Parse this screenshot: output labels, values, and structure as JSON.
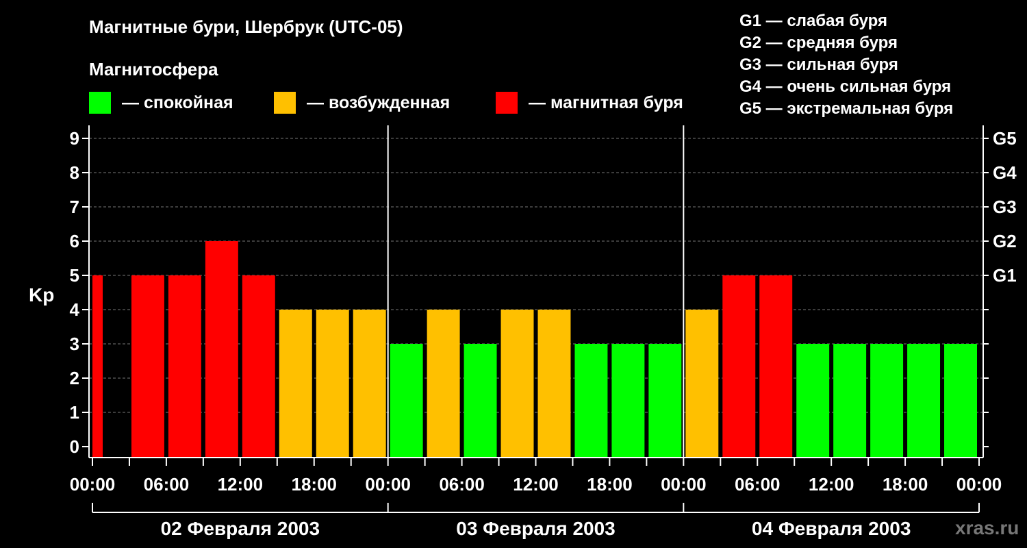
{
  "chart_data": {
    "type": "bar",
    "title": "Магнитные бури, Шербрук (UTC-05)",
    "ylabel": "Kp",
    "ylim": [
      0,
      9
    ],
    "yticks": [
      "0",
      "1",
      "2",
      "3",
      "4",
      "5",
      "6",
      "7",
      "8",
      "9"
    ],
    "g_levels": [
      {
        "label": "G1",
        "kp": 5
      },
      {
        "label": "G2",
        "kp": 6
      },
      {
        "label": "G3",
        "kp": 7
      },
      {
        "label": "G4",
        "kp": 8
      },
      {
        "label": "G5",
        "kp": 9
      }
    ],
    "legend": {
      "title": "Магнитосфера",
      "items": [
        {
          "color": "#00ff00",
          "label": "— спокойная"
        },
        {
          "color": "#ffc000",
          "label": "— возбужденная"
        },
        {
          "color": "#ff0000",
          "label": "— магнитная буря"
        }
      ]
    },
    "g_legend": [
      "G1 — слабая буря",
      "G2 — средняя буря",
      "G3 — сильная буря",
      "G4 — очень сильная буря",
      "G5 — экстремальная буря"
    ],
    "x_ticks": [
      "00:00",
      "06:00",
      "12:00",
      "18:00",
      "00:00",
      "06:00",
      "12:00",
      "18:00",
      "00:00",
      "06:00",
      "12:00",
      "18:00",
      "00:00"
    ],
    "days": [
      "02 Февраля 2003",
      "03 Февраля 2003",
      "04 Февраля 2003"
    ],
    "colors": {
      "quiet": "#00ff00",
      "active": "#ffc000",
      "storm": "#ff0000"
    },
    "bar_hours": [
      0,
      3,
      6,
      9,
      12,
      15,
      18,
      21,
      24,
      27,
      30,
      33,
      36,
      39,
      42,
      45,
      48,
      51,
      54,
      57,
      60,
      63,
      66,
      69
    ],
    "values": [
      5,
      5,
      5,
      6,
      5,
      4,
      4,
      4,
      3,
      4,
      3,
      4,
      4,
      3,
      3,
      3,
      4,
      5,
      5,
      3,
      3,
      3,
      3,
      3
    ],
    "watermark": "xras.ru"
  }
}
